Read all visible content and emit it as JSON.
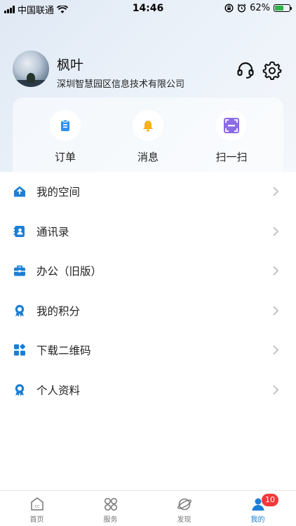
{
  "status_bar": {
    "carrier": "中国联通",
    "time": "14:46",
    "battery": "62%",
    "battery_level": 0.62
  },
  "profile": {
    "name": "枫叶",
    "company": "深圳智慧园区信息技术有限公司"
  },
  "quick_actions": [
    {
      "label": "订单",
      "icon": "clipboard-icon",
      "color": "#2f8ff0"
    },
    {
      "label": "消息",
      "icon": "bell-icon",
      "color": "#f5b21b"
    },
    {
      "label": "扫一扫",
      "icon": "scan-icon",
      "color": "#8c6ce6"
    }
  ],
  "menu": [
    {
      "label": "我的空间",
      "icon": "home-upload-icon"
    },
    {
      "label": "通讯录",
      "icon": "contacts-icon"
    },
    {
      "label": "办公（旧版）",
      "icon": "briefcase-icon"
    },
    {
      "label": "我的积分",
      "icon": "award-icon"
    },
    {
      "label": "下载二维码",
      "icon": "grid-apps-icon"
    },
    {
      "label": "个人资料",
      "icon": "award-icon"
    }
  ],
  "tabs": [
    {
      "label": "首页",
      "icon": "home-cc-icon"
    },
    {
      "label": "服务",
      "icon": "services-icon"
    },
    {
      "label": "发现",
      "icon": "planet-icon"
    },
    {
      "label": "我的",
      "icon": "user-icon",
      "badge": "10",
      "active": true
    }
  ],
  "colors": {
    "accent": "#1a7fd6",
    "badge": "#f0393a"
  }
}
